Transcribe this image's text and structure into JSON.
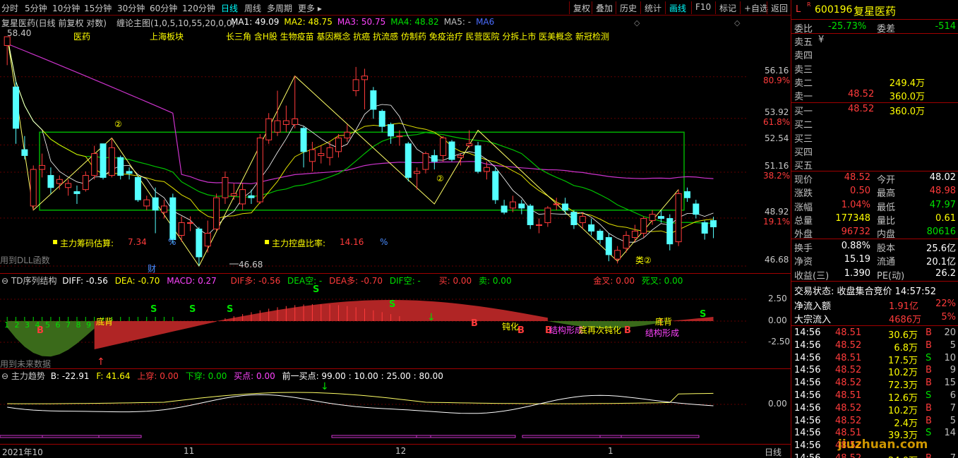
{
  "toolbar": {
    "periods": [
      "分时",
      "5分钟",
      "10分钟",
      "15分钟",
      "30分钟",
      "60分钟",
      "120分钟",
      "日线",
      "周线",
      "多周期",
      "更多 ▸"
    ],
    "active_period": "日线",
    "buttons": [
      "复权",
      "叠加",
      "历史",
      "统计",
      "画线",
      "F10",
      "标记",
      "+自选",
      "返回"
    ],
    "active_button": "画线"
  },
  "main_chart": {
    "title": "复星医药(日线 前复权 对数)",
    "indicator_name": "缠论主图(1,0,5,10,55,20,0,0)",
    "ma": [
      {
        "label": "MA1: 49.09",
        "color": "#ffffff"
      },
      {
        "label": "MA2: 48.75",
        "color": "#ffff00"
      },
      {
        "label": "MA3: 50.75",
        "color": "#ff44ff"
      },
      {
        "label": "MA4: 48.82",
        "color": "#00e000"
      },
      {
        "label": "MA5: -",
        "color": "#c0c0c0"
      },
      {
        "label": "MA6",
        "color": "#4a6cff"
      }
    ],
    "high_label": "58.40",
    "low_label": "46.68",
    "tags": [
      "医药",
      "上海板块",
      "长三角 含H股 生物疫苗 基因概念 抗癌 抗流感 仿制药 免疫治疗 民营医院 分拆上市 医美概念 新冠检测"
    ],
    "chip_label": "主力筹码估算:",
    "chip_value": "7.34",
    "chip_unit": "%",
    "control_label": "主力控盘比率:",
    "control_value": "14.16",
    "control_unit": "%",
    "dll_note": "用到DLL函数",
    "cai_label": "财",
    "circle2_a": "②",
    "circle2_b": "②",
    "lei2": "类②",
    "axis": [
      {
        "price": "56.16",
        "pct": "80.9%"
      },
      {
        "price": "53.92",
        "pct": "61.8%"
      },
      {
        "price": "52.54",
        "pct": ""
      },
      {
        "price": "51.16",
        "pct": "38.2%"
      },
      {
        "price": "48.92",
        "pct": "19.1%"
      },
      {
        "price": "46.68",
        "pct": ""
      }
    ]
  },
  "td_pane": {
    "title": "TD序列结构",
    "diff": "DIFF: -0.56",
    "dea": "DEA: -0.70",
    "macd": "MACD: 0.27",
    "diff_more": "DIF多: -0.56",
    "dea_empty": "DEA空: -",
    "dea_more": "DEA多: -0.70",
    "dif_empty": "DIF空: -",
    "buy": "买: 0.00",
    "sell": "卖: 0.00",
    "golden": "金叉: 0.00",
    "dead": "死叉: 0.00",
    "future_note": "用到未来数据",
    "seq": "1 2 3 4 5 6 7 8 9",
    "labels": [
      "底背",
      "钝化",
      "结构形成",
      "底再次钝化",
      "底背",
      "结构形成"
    ],
    "axis": [
      "2.50",
      "0.00",
      "-2.50"
    ]
  },
  "trend_pane": {
    "title": "主力趋势",
    "b": "B: -22.91",
    "f": "F: 41.64",
    "up": "上穿: 0.00",
    "down": "下穿: 0.00",
    "buy_point": "买点: 0.00",
    "prev_buy": "前一买点: 99.00 : 10.00 : 25.00 : 80.00",
    "axis": [
      "0.00"
    ]
  },
  "x_axis": {
    "labels": [
      "2021年10",
      "11",
      "12",
      "1"
    ],
    "period_tag": "日线"
  },
  "quote": {
    "code": "600196",
    "name": "复星医药",
    "ratio_label": "委比",
    "ratio": "-25.73%",
    "diff_label": "委差",
    "diff": "-514",
    "asks": [
      {
        "label": "卖五",
        "price": "",
        "vol": "",
        "extra": "¥"
      },
      {
        "label": "卖四",
        "price": "",
        "vol": ""
      },
      {
        "label": "卖三",
        "price": "",
        "vol": ""
      },
      {
        "label": "卖二",
        "price": "",
        "vol": "249.4万"
      },
      {
        "label": "卖一",
        "price": "48.52",
        "vol": "360.0万"
      }
    ],
    "bids": [
      {
        "label": "买一",
        "price": "48.52",
        "vol": "360.0万"
      },
      {
        "label": "买二",
        "price": "",
        "vol": ""
      },
      {
        "label": "买三",
        "price": "",
        "vol": ""
      },
      {
        "label": "买四",
        "price": "",
        "vol": ""
      },
      {
        "label": "买五",
        "price": "",
        "vol": ""
      }
    ],
    "stats": [
      {
        "l1": "现价",
        "v1": "48.52",
        "c1": "red",
        "l2": "今开",
        "v2": "48.02",
        "c2": "white"
      },
      {
        "l1": "涨跌",
        "v1": "0.50",
        "c1": "red",
        "l2": "最高",
        "v2": "48.98",
        "c2": "red"
      },
      {
        "l1": "涨幅",
        "v1": "1.04%",
        "c1": "red",
        "l2": "最低",
        "v2": "47.97",
        "c2": "green"
      },
      {
        "l1": "总量",
        "v1": "177348",
        "c1": "yellow",
        "l2": "量比",
        "v2": "0.61",
        "c2": "yellow"
      },
      {
        "l1": "外盘",
        "v1": "96732",
        "c1": "red",
        "l2": "内盘",
        "v2": "80616",
        "c2": "green"
      }
    ],
    "stats2": [
      {
        "l1": "换手",
        "v1": "0.88%",
        "l2": "股本",
        "v2": "25.6亿"
      },
      {
        "l1": "净资",
        "v1": "15.19",
        "l2": "流通",
        "v2": "20.1亿"
      },
      {
        "l1": "收益(三)",
        "v1": "1.390",
        "l2": "PE(动)",
        "v2": "26.2"
      }
    ],
    "trade_state": "交易状态: 收盘集合竞价 14:57:52",
    "net_inflow_label": "净流入额",
    "net_inflow": "1.91亿",
    "net_inflow_pct": "22%",
    "block_inflow_label": "大宗流入",
    "block_inflow": "4686万",
    "block_inflow_pct": "5%",
    "ticks": [
      {
        "t": "14:56",
        "p": "48.51",
        "v": "30.6万",
        "s": "B",
        "n": "20"
      },
      {
        "t": "14:56",
        "p": "48.52",
        "v": "6.8万",
        "s": "B",
        "n": "5"
      },
      {
        "t": "14:56",
        "p": "48.51",
        "v": "17.5万",
        "s": "S",
        "n": "10"
      },
      {
        "t": "14:56",
        "p": "48.52",
        "v": "10.2万",
        "s": "B",
        "n": "9"
      },
      {
        "t": "14:56",
        "p": "48.52",
        "v": "72.3万",
        "s": "B",
        "n": "15"
      },
      {
        "t": "14:56",
        "p": "48.51",
        "v": "12.6万",
        "s": "S",
        "n": "6"
      },
      {
        "t": "14:56",
        "p": "48.52",
        "v": "10.2万",
        "s": "B",
        "n": "7"
      },
      {
        "t": "14:56",
        "p": "48.52",
        "v": "2.4万",
        "s": "B",
        "n": "5"
      },
      {
        "t": "14:56",
        "p": "48.51",
        "v": "39.3万",
        "s": "S",
        "n": "14"
      },
      {
        "t": "14:56",
        "p": "48.52",
        "v": "",
        "s": "",
        "n": ""
      },
      {
        "t": "14:56",
        "p": "48.52",
        "v": "24.0万",
        "s": "B",
        "n": "7"
      }
    ],
    "watermark": "jiuzhuan.com",
    "market_tag": "L",
    "board_tag": "R"
  },
  "candles": [
    {
      "o": 57.9,
      "c": 58.4,
      "h": 58.4,
      "l": 56.8
    },
    {
      "o": 55.6,
      "c": 53.4,
      "h": 55.9,
      "l": 52.6
    },
    {
      "o": 52.3,
      "c": 52.0,
      "h": 53.0,
      "l": 51.8
    },
    {
      "o": 49.5,
      "c": 51.3,
      "h": 51.5,
      "l": 49.3
    },
    {
      "o": 51.3,
      "c": 51.5,
      "h": 52.1,
      "l": 50.9
    },
    {
      "o": 51.0,
      "c": 50.4,
      "h": 51.4,
      "l": 50.1
    },
    {
      "o": 50.6,
      "c": 50.8,
      "h": 51.0,
      "l": 50.3
    },
    {
      "o": 50.4,
      "c": 50.6,
      "h": 50.8,
      "l": 50.0
    },
    {
      "o": 50.2,
      "c": 50.1,
      "h": 50.5,
      "l": 49.6
    },
    {
      "o": 50.3,
      "c": 51.0,
      "h": 51.2,
      "l": 50.2
    },
    {
      "o": 51.0,
      "c": 52.1,
      "h": 52.5,
      "l": 50.8
    },
    {
      "o": 52.6,
      "c": 50.9,
      "h": 52.6,
      "l": 50.8
    },
    {
      "o": 51.0,
      "c": 52.4,
      "h": 52.9,
      "l": 50.9
    },
    {
      "o": 51.9,
      "c": 51.0,
      "h": 52.0,
      "l": 50.8
    },
    {
      "o": 51.2,
      "c": 51.1,
      "h": 51.4,
      "l": 50.8
    },
    {
      "o": 50.9,
      "c": 49.8,
      "h": 51.0,
      "l": 49.7
    },
    {
      "o": 49.5,
      "c": 49.8,
      "h": 50.0,
      "l": 49.3
    },
    {
      "o": 49.9,
      "c": 49.3,
      "h": 50.4,
      "l": 48.2
    },
    {
      "o": 49.2,
      "c": 49.5,
      "h": 49.8,
      "l": 48.9
    },
    {
      "o": 49.9,
      "c": 47.9,
      "h": 50.1,
      "l": 47.7
    },
    {
      "o": 48.1,
      "c": 48.7,
      "h": 49.0,
      "l": 47.8
    },
    {
      "o": 48.7,
      "c": 48.7,
      "h": 49.0,
      "l": 48.3
    },
    {
      "o": 48.4,
      "c": 47.1,
      "h": 48.5,
      "l": 46.68
    },
    {
      "o": 47.6,
      "c": 48.2,
      "h": 48.8,
      "l": 47.3
    },
    {
      "o": 48.4,
      "c": 49.9,
      "h": 50.1,
      "l": 48.3
    },
    {
      "o": 49.9,
      "c": 50.9,
      "h": 51.2,
      "l": 49.6
    },
    {
      "o": 50.0,
      "c": 50.1,
      "h": 50.6,
      "l": 49.8
    },
    {
      "o": 49.6,
      "c": 50.3,
      "h": 50.6,
      "l": 49.3
    },
    {
      "o": 50.0,
      "c": 49.9,
      "h": 50.3,
      "l": 49.6
    },
    {
      "o": 49.7,
      "c": 52.9,
      "h": 53.1,
      "l": 49.6
    },
    {
      "o": 52.8,
      "c": 53.9,
      "h": 54.2,
      "l": 52.6
    },
    {
      "o": 53.2,
      "c": 53.8,
      "h": 55.4,
      "l": 53.0
    },
    {
      "o": 53.6,
      "c": 53.8,
      "h": 54.6,
      "l": 53.2
    },
    {
      "o": 53.6,
      "c": 53.9,
      "h": 56.2,
      "l": 53.4
    },
    {
      "o": 53.4,
      "c": 52.2,
      "h": 53.5,
      "l": 51.4
    },
    {
      "o": 51.7,
      "c": 52.3,
      "h": 52.7,
      "l": 51.2
    },
    {
      "o": 52.0,
      "c": 52.1,
      "h": 52.5,
      "l": 51.6
    },
    {
      "o": 51.9,
      "c": 52.4,
      "h": 52.7,
      "l": 51.5
    },
    {
      "o": 52.2,
      "c": 52.9,
      "h": 53.1,
      "l": 51.9
    },
    {
      "o": 52.9,
      "c": 53.2,
      "h": 53.6,
      "l": 52.7
    },
    {
      "o": 55.4,
      "c": 56.0,
      "h": 56.7,
      "l": 55.1
    },
    {
      "o": 56.0,
      "c": 56.2,
      "h": 56.6,
      "l": 54.4
    },
    {
      "o": 55.4,
      "c": 54.4,
      "h": 55.6,
      "l": 53.9
    },
    {
      "o": 54.3,
      "c": 53.5,
      "h": 54.4,
      "l": 53.2
    },
    {
      "o": 53.6,
      "c": 53.0,
      "h": 53.7,
      "l": 52.6
    },
    {
      "o": 53.0,
      "c": 53.0,
      "h": 53.3,
      "l": 52.5
    },
    {
      "o": 52.6,
      "c": 50.9,
      "h": 52.7,
      "l": 50.7
    },
    {
      "o": 51.1,
      "c": 51.2,
      "h": 51.4,
      "l": 50.3
    },
    {
      "o": 51.3,
      "c": 52.1,
      "h": 52.2,
      "l": 51.1
    },
    {
      "o": 52.0,
      "c": 51.7,
      "h": 52.3,
      "l": 51.3
    },
    {
      "o": 52.0,
      "c": 52.9,
      "h": 53.0,
      "l": 51.7
    },
    {
      "o": 52.7,
      "c": 51.8,
      "h": 52.8,
      "l": 51.7
    },
    {
      "o": 51.9,
      "c": 52.0,
      "h": 52.1,
      "l": 51.5
    },
    {
      "o": 52.5,
      "c": 52.6,
      "h": 53.3,
      "l": 52.4
    },
    {
      "o": 52.5,
      "c": 51.2,
      "h": 52.7,
      "l": 51.1
    },
    {
      "o": 51.2,
      "c": 51.4,
      "h": 51.7,
      "l": 50.8
    },
    {
      "o": 51.2,
      "c": 49.8,
      "h": 51.4,
      "l": 49.6
    },
    {
      "o": 49.5,
      "c": 49.2,
      "h": 49.8,
      "l": 49.1
    },
    {
      "o": 49.4,
      "c": 49.7,
      "h": 50.0,
      "l": 49.2
    },
    {
      "o": 49.6,
      "c": 49.4,
      "h": 49.8,
      "l": 49.1
    },
    {
      "o": 49.5,
      "c": 48.6,
      "h": 49.6,
      "l": 48.4
    },
    {
      "o": 48.6,
      "c": 48.6,
      "h": 48.9,
      "l": 48.2
    },
    {
      "o": 48.7,
      "c": 49.4,
      "h": 49.5,
      "l": 48.5
    },
    {
      "o": 49.6,
      "c": 49.6,
      "h": 49.9,
      "l": 49.3
    },
    {
      "o": 49.6,
      "c": 49.3,
      "h": 49.9,
      "l": 49.1
    },
    {
      "o": 49.2,
      "c": 48.6,
      "h": 49.3,
      "l": 48.4
    },
    {
      "o": 48.7,
      "c": 49.0,
      "h": 49.2,
      "l": 48.4
    },
    {
      "o": 48.6,
      "c": 48.3,
      "h": 48.9,
      "l": 48.1
    },
    {
      "o": 48.3,
      "c": 47.9,
      "h": 48.4,
      "l": 47.7
    },
    {
      "o": 48.0,
      "c": 47.2,
      "h": 48.2,
      "l": 46.9
    },
    {
      "o": 47.0,
      "c": 47.4,
      "h": 47.6,
      "l": 46.8
    },
    {
      "o": 47.5,
      "c": 48.1,
      "h": 48.3,
      "l": 47.3
    },
    {
      "o": 48.0,
      "c": 48.3,
      "h": 48.6,
      "l": 47.8
    },
    {
      "o": 48.2,
      "c": 48.9,
      "h": 49.0,
      "l": 48.0
    },
    {
      "o": 48.8,
      "c": 49.1,
      "h": 49.3,
      "l": 48.6
    },
    {
      "o": 49.0,
      "c": 48.9,
      "h": 49.3,
      "l": 48.7
    },
    {
      "o": 48.9,
      "c": 47.7,
      "h": 49.1,
      "l": 47.4
    },
    {
      "o": 47.8,
      "c": 50.1,
      "h": 50.3,
      "l": 47.6
    },
    {
      "o": 50.2,
      "c": 49.9,
      "h": 50.4,
      "l": 49.7
    },
    {
      "o": 49.6,
      "c": 49.1,
      "h": 49.8,
      "l": 48.9
    },
    {
      "o": 48.7,
      "c": 48.2,
      "h": 48.8,
      "l": 47.9
    },
    {
      "o": 48.8,
      "c": 48.5,
      "h": 48.98,
      "l": 47.97
    }
  ]
}
